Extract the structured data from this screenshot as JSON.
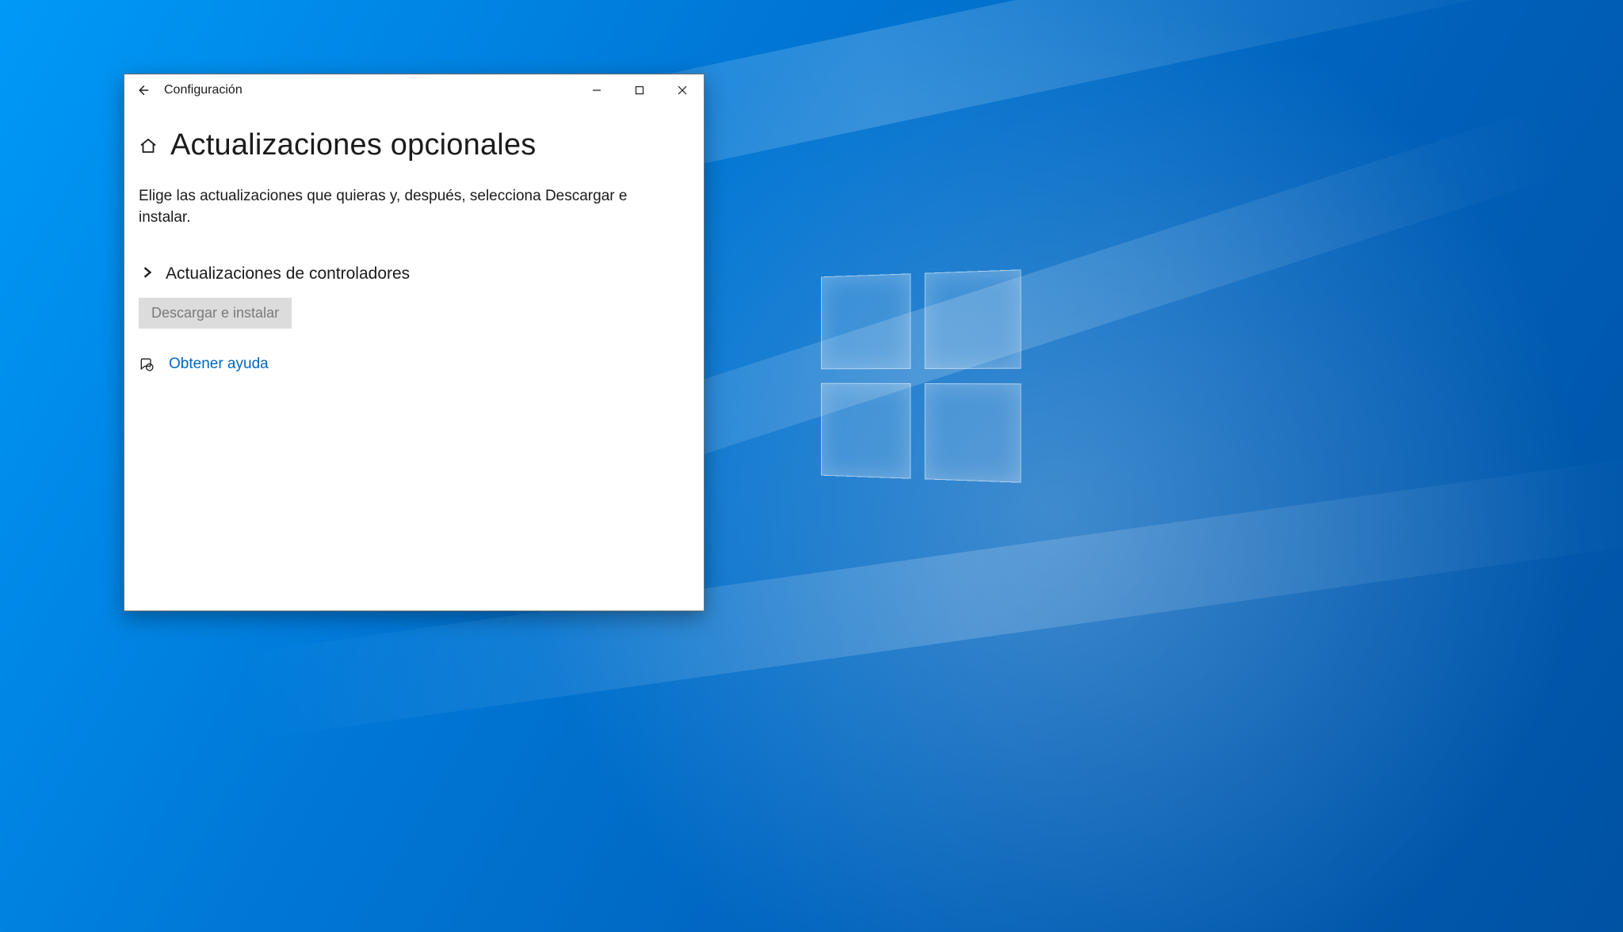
{
  "window": {
    "app_name": "Configuración",
    "page_title": "Actualizaciones opcionales",
    "description": "Elige las actualizaciones que quieras y, después, selecciona Descargar e instalar.",
    "section_title": "Actualizaciones de controladores",
    "download_button": "Descargar e instalar",
    "help_link": "Obtener ayuda"
  }
}
